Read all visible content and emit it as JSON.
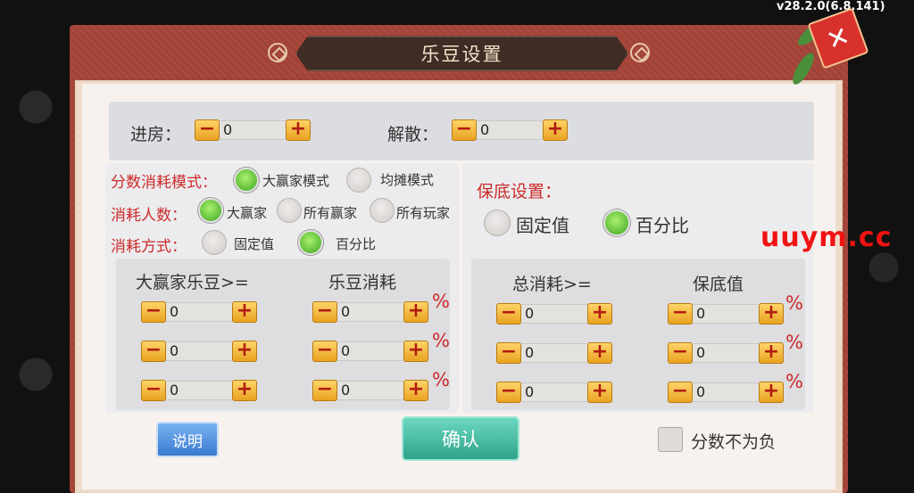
{
  "version": "v28.2.0(6.8.141)",
  "title": "乐豆设置",
  "close_glyph": "✕",
  "watermark": "uuym.cc",
  "top_row": {
    "enter_label": "进房：",
    "enter_value": "0",
    "dissolve_label": "解散：",
    "dissolve_value": "0"
  },
  "left": {
    "mode_label": "分数消耗模式：",
    "mode_options": [
      "大赢家模式",
      "均摊模式"
    ],
    "mode_selected": "大赢家模式",
    "people_label": "消耗人数：",
    "people_options": [
      "大赢家",
      "所有赢家",
      "所有玩家"
    ],
    "people_selected": "大赢家",
    "method_label": "消耗方式：",
    "method_options": [
      "固定值",
      "百分比"
    ],
    "method_selected": "百分比",
    "col1_header": "大赢家乐豆>=",
    "col2_header": "乐豆消耗",
    "rows": [
      {
        "threshold": "0",
        "cost": "0",
        "unit": "%"
      },
      {
        "threshold": "0",
        "cost": "0",
        "unit": "%"
      },
      {
        "threshold": "0",
        "cost": "0",
        "unit": "%"
      }
    ]
  },
  "right": {
    "section_label": "保底设置：",
    "options": [
      "固定值",
      "百分比"
    ],
    "selected": "百分比",
    "col1_header": "总消耗>=",
    "col2_header": "保底值",
    "rows": [
      {
        "threshold": "0",
        "value": "0",
        "unit": "%"
      },
      {
        "threshold": "0",
        "value": "0",
        "unit": "%"
      },
      {
        "threshold": "0",
        "value": "0",
        "unit": "%"
      }
    ]
  },
  "stepper_minus": "−",
  "stepper_plus": "+",
  "footer": {
    "help_label": "说明",
    "confirm_label": "确认",
    "nonneg_label": "分数不为负"
  },
  "colors": {
    "accent_red": "#cc2a2a",
    "frame": "#a8473b",
    "confirm": "#2fa48b"
  }
}
